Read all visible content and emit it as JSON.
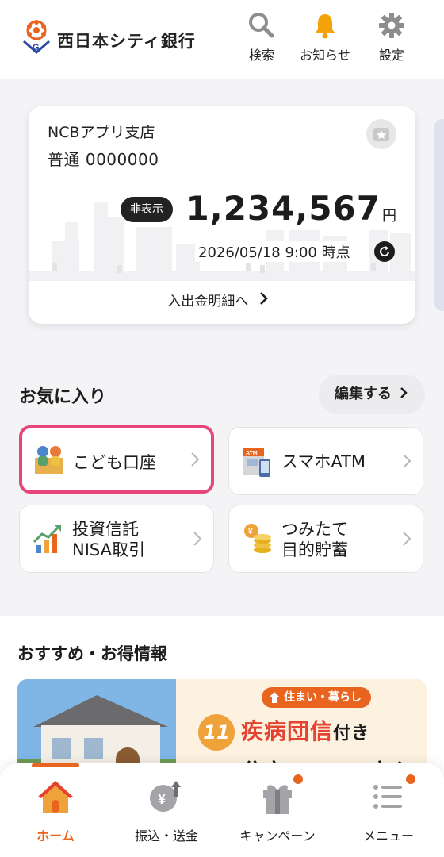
{
  "header": {
    "bank_name": "西日本シティ銀行",
    "search_label": "検索",
    "notice_label": "お知らせ",
    "settings_label": "設定"
  },
  "account": {
    "branch": "NCBアプリ支店",
    "account_number": "普通 0000000",
    "hide_label": "非表示",
    "balance": "1,234,567",
    "currency": "円",
    "as_of": "2026/05/18 9:00 時点",
    "detail_link": "入出金明細へ"
  },
  "favorites": {
    "title": "お気に入り",
    "edit_label": "編集する",
    "tiles": [
      {
        "label": "こども口座"
      },
      {
        "label": "スマホATM"
      },
      {
        "label": "投資信託\nNISA取引"
      },
      {
        "label": "つみたて\n目的貯蓄"
      }
    ]
  },
  "recommend": {
    "title": "おすすめ・お得情報",
    "banner": {
      "tag": "住まい・暮らし",
      "number": "11",
      "headline": "疾病団信",
      "headline_suffix": "付き",
      "subline": "住宅ローンで安心"
    }
  },
  "bottom_nav": {
    "items": [
      {
        "label": "ホーム",
        "active": true
      },
      {
        "label": "振込・送金"
      },
      {
        "label": "キャンペーン"
      },
      {
        "label": "メニュー"
      }
    ]
  },
  "colors": {
    "accent": "#e8641f",
    "highlight": "#e8457a",
    "brand_red": "#e5432f"
  },
  "icons": {
    "search": "search-icon",
    "notice": "bell-icon",
    "settings": "gear-icon"
  }
}
